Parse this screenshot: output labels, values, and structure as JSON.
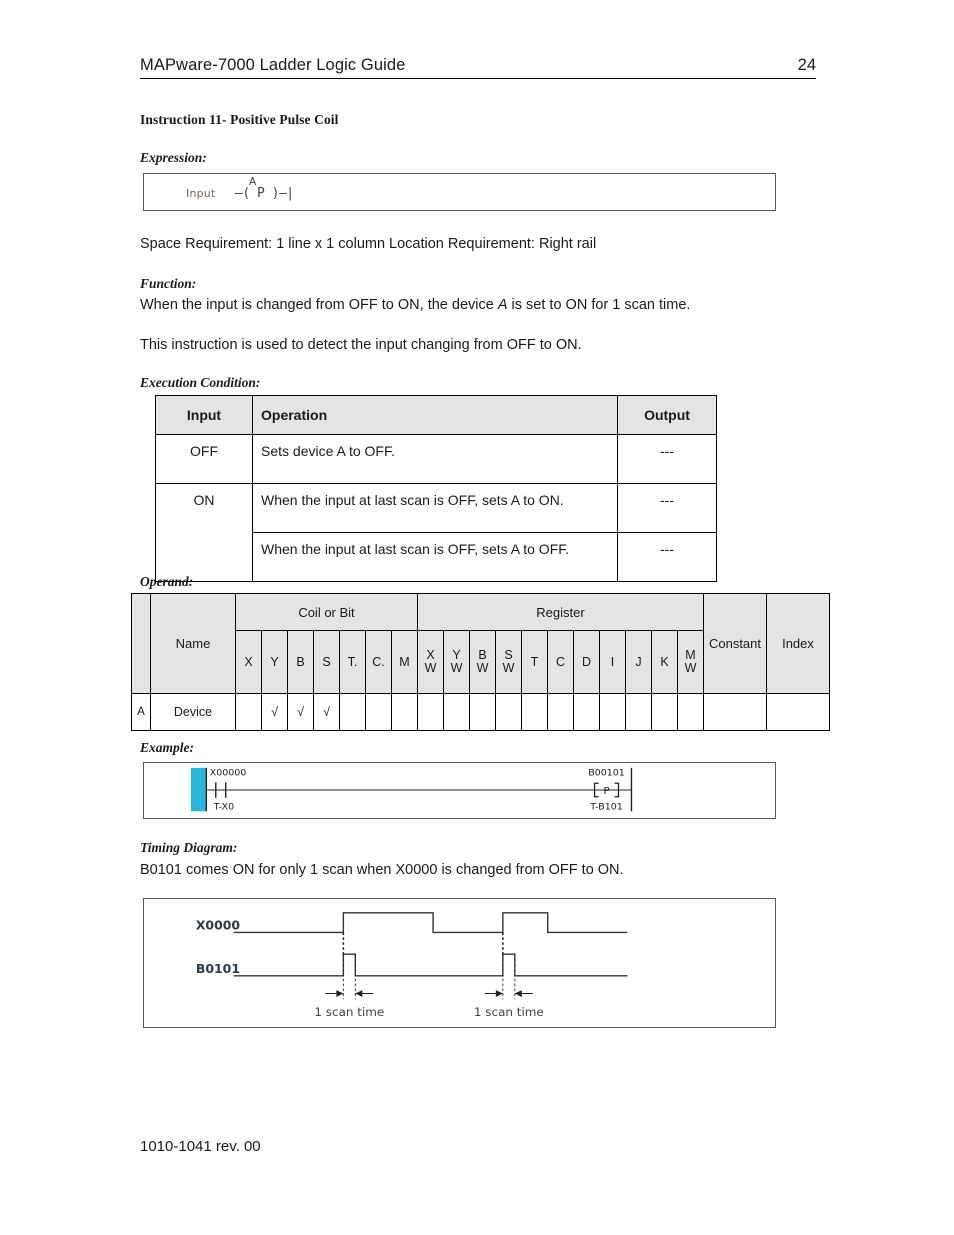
{
  "header": {
    "title": "MAPware-7000 Ladder Logic Guide",
    "page_number": "24"
  },
  "instruction": {
    "title": "Instruction 11- Positive Pulse Coil"
  },
  "sections": {
    "expression_label": "Expression:",
    "function_label": "Function:",
    "execution_condition_label": "Execution Condition:",
    "operand_label": "Operand:",
    "example_label": "Example:",
    "timing_diagram_label": "Timing Diagram:"
  },
  "expression_figure": {
    "input_label": "Input",
    "device_label": "A",
    "coil_symbol": "—( P )—|",
    "input_color": "#7a6a4a",
    "coil_color": "#2f4f3f"
  },
  "requirements": {
    "line": "Space Requirement: 1 line x 1 column     Location Requirement: Right rail"
  },
  "function_text": {
    "line1_before": "When the input is changed from OFF to ON, the device ",
    "line1_italic": "A",
    "line1_after": " is set to ON for 1 scan time.",
    "line2": "This instruction is used to detect the input changing from OFF to ON."
  },
  "execution_table": {
    "headers": [
      "Input",
      "Operation",
      "Output"
    ],
    "header_bg": "#e4e4e4",
    "rows": [
      {
        "input": "OFF",
        "operation": "Sets device A to OFF.",
        "output": "---"
      },
      {
        "input": "ON",
        "operation": "When the input at last scan is OFF, sets A to ON.",
        "output": "---"
      },
      {
        "input": "",
        "operation": "When the input at last scan is OFF, sets A to OFF.",
        "output": "---"
      }
    ]
  },
  "operand_table": {
    "group_headers": {
      "coil_or_bit": "Coil or Bit",
      "register": "Register",
      "constant": "Constant",
      "index": "Index"
    },
    "name_header": "Name",
    "bit_columns": [
      "X",
      "Y",
      "B",
      "S",
      "T.",
      "C.",
      "M"
    ],
    "register_columns": [
      {
        "top": "X",
        "bottom": "W"
      },
      {
        "top": "Y",
        "bottom": "W"
      },
      {
        "top": "B",
        "bottom": "W"
      },
      {
        "top": "S",
        "bottom": "W"
      },
      {
        "top": "T",
        "bottom": ""
      },
      {
        "top": "C",
        "bottom": ""
      },
      {
        "top": "D",
        "bottom": ""
      },
      {
        "top": "I",
        "bottom": ""
      },
      {
        "top": "J",
        "bottom": ""
      },
      {
        "top": "K",
        "bottom": ""
      },
      {
        "top": "M",
        "bottom": "W"
      }
    ],
    "row": {
      "operand": "A",
      "name": "Device",
      "bit_marks": [
        "",
        "√",
        "√",
        "√",
        "",
        "",
        ""
      ],
      "register_marks": [
        "",
        "",
        "",
        "",
        "",
        "",
        "",
        "",
        "",
        "",
        ""
      ],
      "constant_mark": "",
      "index_mark": ""
    },
    "check_glyph": "√"
  },
  "example_figure": {
    "contact_tag": "X00000",
    "contact_comment": "T-X0",
    "coil_tag": "B00101",
    "coil_symbol": "P",
    "coil_comment": "T-B101",
    "selection_color": "#29b6d8"
  },
  "timing": {
    "description": "B0101 comes ON for only 1 scan when X0000 is changed from OFF to ON.",
    "signals": [
      {
        "name": "X0000",
        "pulses": [
          {
            "start": 200,
            "end": 290
          },
          {
            "start": 360,
            "end": 405
          }
        ]
      },
      {
        "name": "B0101",
        "pulses": [
          {
            "start": 200,
            "end": 212
          },
          {
            "start": 360,
            "end": 372
          }
        ]
      }
    ],
    "annotations": [
      "1 scan time",
      "1 scan time"
    ],
    "label_color": "#2b3a52",
    "annotation_color": "#4a4038"
  },
  "footer": {
    "text": "1010-1041 rev. 00"
  }
}
